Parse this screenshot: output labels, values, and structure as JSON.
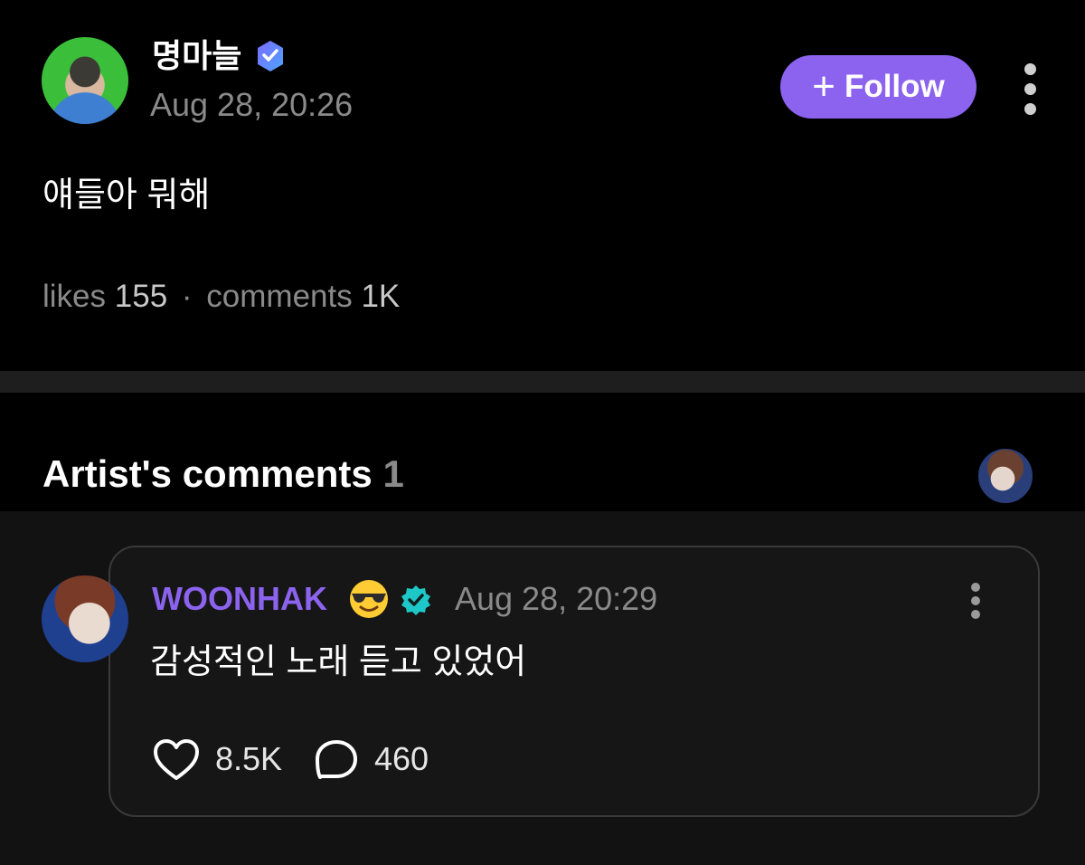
{
  "post": {
    "author": "명마늘",
    "timestamp": "Aug 28, 20:26",
    "body": "얘들아 뭐해",
    "follow_label": "Follow",
    "stats": {
      "likes_label": "likes",
      "likes": "155",
      "separator": "·",
      "comments_label": "comments",
      "comments": "1K"
    }
  },
  "artist_comments": {
    "title": "Artist's comments",
    "count": "1"
  },
  "comment": {
    "author": "WOONHAK",
    "timestamp": "Aug 28, 20:29",
    "text": "감성적인 노래 듣고 있었어",
    "likes": "8.5K",
    "replies": "460"
  },
  "icons": {
    "author_badge": "verified-heart-badge-icon",
    "commenter_badge": "verified-check-badge-icon",
    "emoji": "sunglasses-emoji-icon",
    "like": "heart-icon",
    "reply": "speech-bubble-icon",
    "more": "vertical-dots-icon"
  },
  "colors": {
    "accent_purple": "#8c63ee",
    "verified_teal": "#1ec8c8",
    "muted_text": "#8a8a8a",
    "background": "#000000"
  }
}
